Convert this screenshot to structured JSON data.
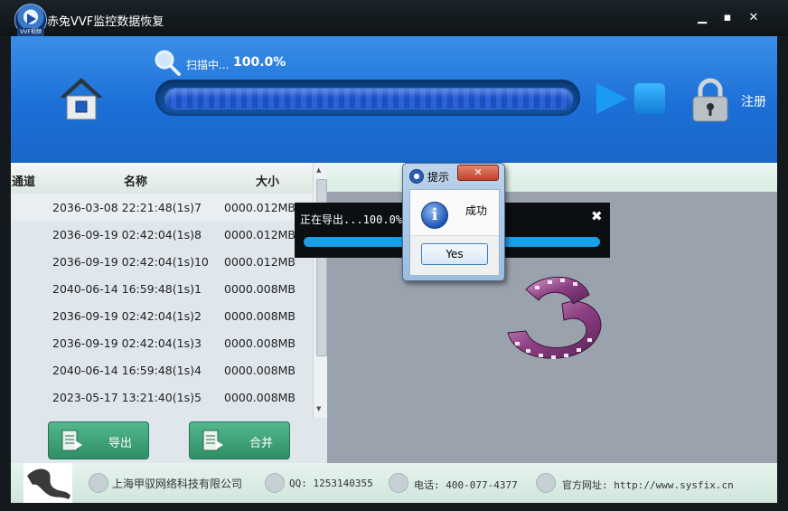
{
  "window": {
    "title": "赤兔VVF监控数据恢复",
    "logo_tag": "VVF视频"
  },
  "header": {
    "scan_label": "扫描中...",
    "scan_percent": "100.0%",
    "scan_progress": 1.0,
    "register_label": "注册"
  },
  "list": {
    "columns": [
      "通道",
      "名称",
      "大小"
    ],
    "rows": [
      {
        "name": "2036-03-08 22:21:48(1s)7",
        "size": "0000.012MB"
      },
      {
        "name": "2036-09-19 02:42:04(1s)8",
        "size": "0000.012MB"
      },
      {
        "name": "2036-09-19 02:42:04(1s)10",
        "size": "0000.012MB"
      },
      {
        "name": "2040-06-14 16:59:48(1s)1",
        "size": "0000.008MB"
      },
      {
        "name": "2036-09-19 02:42:04(1s)2",
        "size": "0000.008MB"
      },
      {
        "name": "2036-09-19 02:42:04(1s)3",
        "size": "0000.008MB"
      },
      {
        "name": "2040-06-14 16:59:48(1s)4",
        "size": "0000.008MB"
      },
      {
        "name": "2023-05-17 13:21:40(1s)5",
        "size": "0000.008MB"
      }
    ],
    "export_label": "导出",
    "merge_label": "合并"
  },
  "toast": {
    "text": "正在导出...100.0%",
    "progress": 1.0
  },
  "dialog": {
    "title": "提示",
    "message": "成功",
    "yes_label": "Yes"
  },
  "footer": {
    "company": "上海甲驭网络科技有限公司",
    "qq": "QQ: 1253140355",
    "phone": "电话: 400-077-4377",
    "website": "官方网址: http://www.sysfix.cn"
  },
  "colors": {
    "header_blue": "#1c6fd6",
    "action_green": "#3fa37a",
    "progress_blue": "#1a9ee8"
  }
}
